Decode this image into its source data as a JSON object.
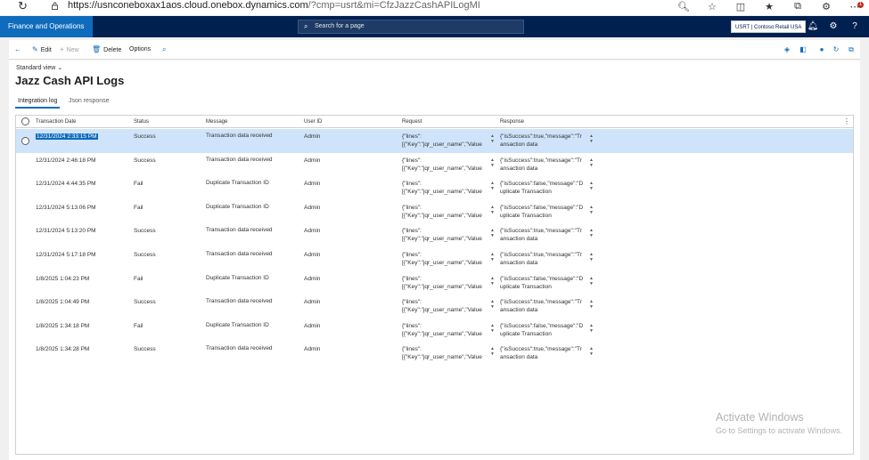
{
  "browser": {
    "url_host": "https://usnconeboxax1aos.cloud.onebox.dynamics.com",
    "url_rest": "/?cmp=usrt&mi=CfzJazzCashAPILogMI",
    "notification_count": "1"
  },
  "nav": {
    "app_title": "Finance and Operations",
    "search_placeholder": "Search for a page",
    "company": "USRT | Contoso Retail USA"
  },
  "actions": {
    "edit": "Edit",
    "new": "New",
    "delete": "Delete",
    "options": "Options"
  },
  "page": {
    "view": "Standard view",
    "title": "Jazz Cash API Logs",
    "tabs": [
      "Integration log",
      "Json response"
    ]
  },
  "grid": {
    "columns": [
      "Transaction Date",
      "Status",
      "Message",
      "User ID",
      "Request",
      "Response"
    ],
    "rows": [
      {
        "date": "12/31/2024 2:33:15 PM",
        "status": "Success",
        "message": "Transaction data received",
        "user": "Admin",
        "request": "{\"lines\":\n[{\"Key\":\"jqr_user_name\",\"Value",
        "response": "{\"isSuccess\":true,\"message\":\"Tr\nansaction data"
      },
      {
        "date": "12/31/2024 2:46:18 PM",
        "status": "Success",
        "message": "Transaction data received",
        "user": "Admin",
        "request": "{\"lines\":\n[{\"Key\":\"jqr_user_name\",\"Value",
        "response": "{\"isSuccess\":true,\"message\":\"Tr\nansaction data"
      },
      {
        "date": "12/31/2024 4:44:35 PM",
        "status": "Fail",
        "message": "Duplicate Transaction ID",
        "user": "Admin",
        "request": "{\"lines\":\n[{\"Key\":\"jqr_user_name\",\"Value",
        "response": "{\"isSuccess\":false,\"message\":\"D\nuplicate Transaction"
      },
      {
        "date": "12/31/2024 5:13:06 PM",
        "status": "Fail",
        "message": "Duplicate Transaction ID",
        "user": "Admin",
        "request": "{\"lines\":\n[{\"Key\":\"jqr_user_name\",\"Value",
        "response": "{\"isSuccess\":false,\"message\":\"D\nuplicate Transaction"
      },
      {
        "date": "12/31/2024 5:13:20 PM",
        "status": "Success",
        "message": "Transaction data received",
        "user": "Admin",
        "request": "{\"lines\":\n[{\"Key\":\"jqr_user_name\",\"Value",
        "response": "{\"isSuccess\":true,\"message\":\"Tr\nansaction data"
      },
      {
        "date": "12/31/2024 5:17:18 PM",
        "status": "Success",
        "message": "Transaction data received",
        "user": "Admin",
        "request": "{\"lines\":\n[{\"Key\":\"jqr_user_name\",\"Value",
        "response": "{\"isSuccess\":true,\"message\":\"Tr\nansaction data"
      },
      {
        "date": "1/8/2025 1:04:23 PM",
        "status": "Fail",
        "message": "Duplicate Transaction ID",
        "user": "Admin",
        "request": "{\"lines\":\n[{\"Key\":\"jqr_user_name\",\"Value",
        "response": "{\"isSuccess\":false,\"message\":\"D\nuplicate Transaction"
      },
      {
        "date": "1/8/2025 1:04:49 PM",
        "status": "Success",
        "message": "Transaction data received",
        "user": "Admin",
        "request": "{\"lines\":\n[{\"Key\":\"jqr_user_name\",\"Value",
        "response": "{\"isSuccess\":true,\"message\":\"Tr\nansaction data"
      },
      {
        "date": "1/8/2025 1:34:18 PM",
        "status": "Fail",
        "message": "Duplicate Transaction ID",
        "user": "Admin",
        "request": "{\"lines\":\n[{\"Key\":\"jqr_user_name\",\"Value",
        "response": "{\"isSuccess\":false,\"message\":\"D\nuplicate Transaction"
      },
      {
        "date": "1/8/2025 1:34:28 PM",
        "status": "Success",
        "message": "Transaction data received",
        "user": "Admin",
        "request": "{\"lines\":\n[{\"Key\":\"jqr_user_name\",\"Value",
        "response": "{\"isSuccess\":true,\"message\":\"Tr\nansaction data"
      }
    ]
  },
  "watermark": {
    "line1": "Activate Windows",
    "line2": "Go to Settings to activate Windows."
  }
}
